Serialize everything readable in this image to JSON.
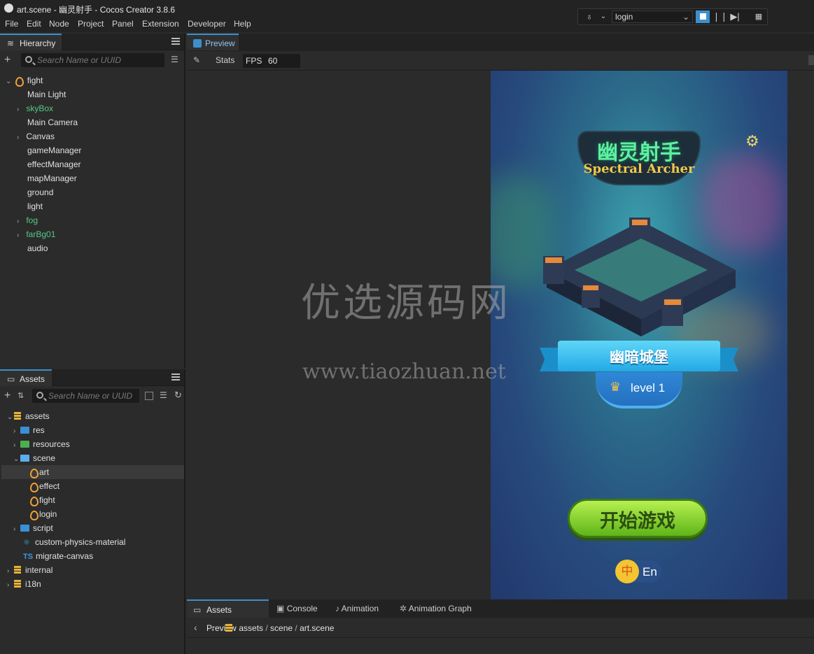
{
  "window": {
    "title": "art.scene - 幽灵射手 - Cocos Creator 3.8.6"
  },
  "menu": [
    "File",
    "Edit",
    "Node",
    "Project",
    "Panel",
    "Extension",
    "Developer",
    "Help"
  ],
  "toolbar": {
    "scene_select": "login"
  },
  "hierarchy": {
    "tab": "Hierarchy",
    "search_placeholder": "Search Name or UUID",
    "root": "fight",
    "nodes": [
      "Main Light",
      "skyBox",
      "Main Camera",
      "Canvas",
      "gameManager",
      "effectManager",
      "mapManager",
      "ground",
      "light",
      "fog",
      "farBg01",
      "audio"
    ]
  },
  "preview": {
    "tab": "Preview",
    "stats_label": "Stats",
    "fps_label": "FPS",
    "fps_value": "60"
  },
  "game": {
    "logo_cn": "幽灵射手",
    "logo_en": "Spectral Archer",
    "castle_name": "幽暗城堡",
    "level": "level 1",
    "start_button": "开始游戏",
    "lang_cn": "中",
    "lang_en": "En"
  },
  "watermark": {
    "line1": "优选源码网",
    "line2": "www.tiaozhuan.net"
  },
  "assets": {
    "tab": "Assets",
    "search_placeholder": "Search Name or UUID",
    "tree": [
      "assets",
      "res",
      "resources",
      "scene",
      "art",
      "effect",
      "fight",
      "login",
      "script",
      "custom-physics-material",
      "migrate-canvas",
      "internal",
      "i18n"
    ]
  },
  "bottom": {
    "tabs": [
      "Assets Preview",
      "Console",
      "Animation",
      "Animation Graph"
    ],
    "path": [
      "assets",
      "scene",
      "art.scene"
    ]
  },
  "colors": {
    "accent": "#3d8fcc",
    "green_node": "#54c98a",
    "fire": "#f0a03a"
  }
}
